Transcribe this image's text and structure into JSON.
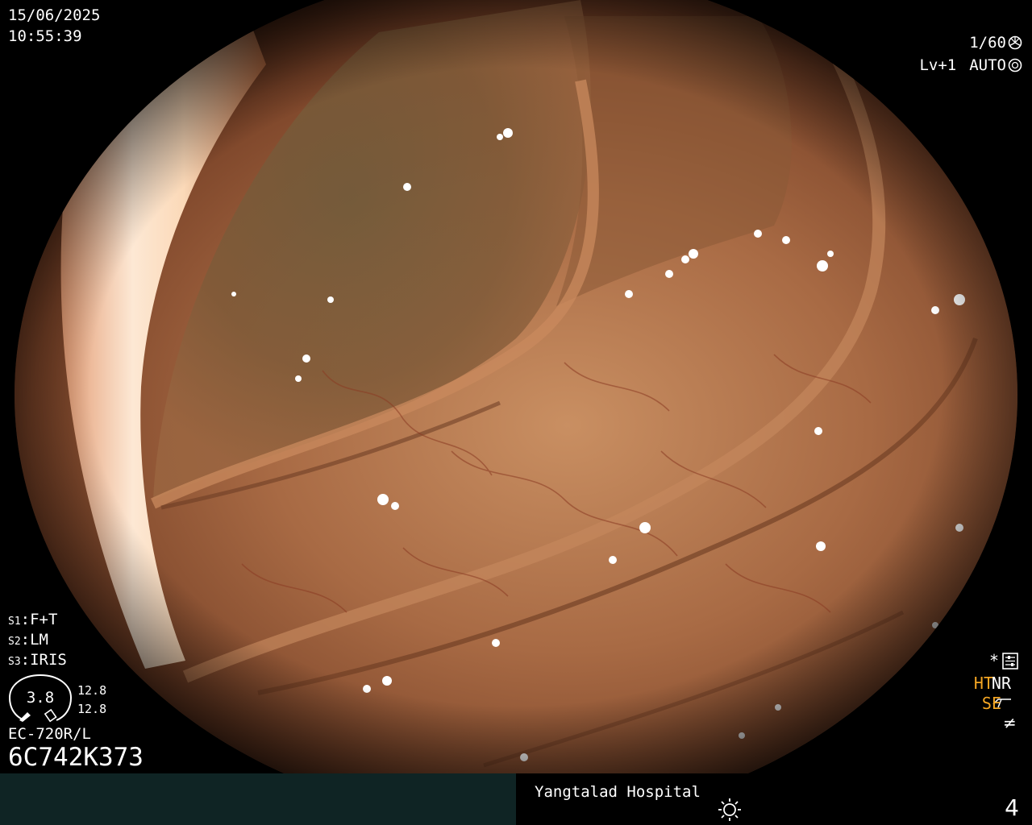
{
  "header": {
    "date": "15/06/2025",
    "time": "10:55:39"
  },
  "camera": {
    "shutter": "1/60",
    "level": "Lv+1",
    "iris_mode": "AUTO"
  },
  "settings": {
    "s1_label": "S1",
    "s1_value": "F+T",
    "s2_label": "S2",
    "s2_value": "LM",
    "s3_label": "S3",
    "s3_value": "IRIS"
  },
  "gauge": {
    "value": "3.8",
    "reading_top": "12.8",
    "reading_bottom": "12.8"
  },
  "scope": {
    "model": "EC-720R/L",
    "serial": "6C742K373"
  },
  "modes": {
    "ht": "HT",
    "nr": "NR",
    "se": "SE"
  },
  "footer": {
    "hospital": "Yangtalad Hospital",
    "page": "4"
  },
  "colors": {
    "footer_left_bg": "#0f2424",
    "accent_orange": "#f5a623"
  },
  "icons": {
    "shutter": "aperture-icon",
    "iris": "iris-icon",
    "settings": "sliders-icon",
    "se": "se-curve-icon",
    "not-equal": "not-equal-icon",
    "light": "sun-icon"
  }
}
